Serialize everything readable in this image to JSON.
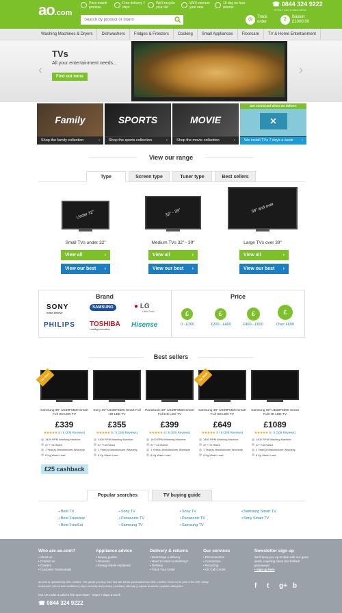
{
  "header": {
    "logo": "ao",
    "logo_domain": ".com",
    "search_placeholder": "Search by product or brand",
    "usps": [
      "Price match promise",
      "Free delivery 7 days",
      "We'll recycle your old",
      "We'll connect your new",
      "15 day no fuss returns"
    ],
    "phone": "0844 324 9222",
    "phone_sub": "OPEN 7 DAYS 8AM-10PM",
    "track_label": "Track order",
    "basket_label": "Basket",
    "basket_amount": "£1000.00",
    "basket_count": "2"
  },
  "nav": [
    "Washing Machines & Dryers",
    "Dishwashers",
    "Fridges & Freezers",
    "Cooking",
    "Small Appliances",
    "Floorcare",
    "TV & Home Entertainment"
  ],
  "hero": {
    "title": "TVs",
    "subtitle": "All your entertainment needs...",
    "button": "Find out more"
  },
  "collections": [
    {
      "art": "Family",
      "label": "Shop the family collection"
    },
    {
      "art": "SPORTS",
      "label": "Shop the sports collection"
    },
    {
      "art": "MOVIE",
      "label": "Shop the movie collection"
    },
    {
      "art": "",
      "label": "We install TVs 7 days a week",
      "heading": "Get connected when we deliver!"
    }
  ],
  "range": {
    "title": "View our range",
    "tabs": [
      "Type",
      "Screen type",
      "Tuner type",
      "Best sellers"
    ],
    "items": [
      {
        "diag": "Under 32\"",
        "caption": "Small TVs under 32\"",
        "view_all": "View all",
        "view_best": "View our best"
      },
      {
        "diag": "32\" - 39\"",
        "caption": "Medium TVs 32\" - 39\"",
        "view_all": "View all",
        "view_best": "View our best"
      },
      {
        "diag": "39\" and over",
        "caption": "Large TVs over 39\"",
        "view_all": "View all",
        "view_best": "View our best"
      }
    ]
  },
  "brand": {
    "title": "Brand",
    "logos": [
      "SONY",
      "SAMSUNG",
      "LG",
      "PHILIPS",
      "TOSHIBA",
      "Hisense"
    ],
    "sony_tagline": "make.believe",
    "lg_tagline": "Life's Good",
    "toshiba_tagline": "Leading Innovation"
  },
  "price": {
    "title": "Price",
    "ranges": [
      "0 - £200",
      "£200 - £400",
      "£400 - £600",
      "Over £600"
    ],
    "symbol": "£"
  },
  "best_sellers": {
    "title": "Best sellers",
    "badge": "Our Best",
    "products": [
      {
        "name": "Samsung 39\" UE39F5500 Smart Full HD LED TV",
        "price": "£339",
        "rating": "★★★★★",
        "reviews": "5 / 5 (306 Reviews)",
        "badge": true
      },
      {
        "name": "Sony 39\" UE39F5500 Smart Full HD LED TV",
        "price": "£355",
        "rating": "★★★★★",
        "reviews": "5 / 5 (306 Reviews)",
        "badge": false
      },
      {
        "name": "Panasonic 39\" UE39F5500 Smart Full HD LED TV",
        "price": "£399",
        "rating": "★★★★★",
        "reviews": "5 / 5 (306 Reviews)",
        "badge": false
      },
      {
        "name": "Samsung 39\" UE39F5500 Smart Full HD LED TV",
        "price": "£649",
        "rating": "★★★★★",
        "reviews": "5 / 5 (306 Reviews)",
        "badge": true
      },
      {
        "name": "Samsung 39\" UE39F5500 Smart Full HD LED TV",
        "price": "£1089",
        "rating": "★★★★★",
        "reviews": "5 / 5 (306 Reviews)",
        "badge": false
      }
    ],
    "features": [
      "1400 RPM Washing Machine",
      "A+++/A Rated",
      "1 Year(s) Manufacturer Warranty",
      "8 Kg Wash Load"
    ],
    "cashback": "£25 cashback"
  },
  "popular": {
    "tabs": [
      "Popular searches",
      "TV buying guide"
    ],
    "columns": [
      [
        "Best TV",
        "Best Freeview",
        "Best FreeSat"
      ],
      [
        "Sony TV",
        "Panasonic TV",
        "Samsung TV"
      ],
      [
        "Sony TV",
        "Panasonic TV",
        "Samsung TV"
      ],
      [
        "Samsung Smart TV",
        "Sony Smart TV"
      ]
    ]
  },
  "footer": {
    "columns": [
      {
        "heading": "Who are ao.com?",
        "links": [
          "About us",
          "Contact us",
          "Careers",
          "Customer Testimonials"
        ]
      },
      {
        "heading": "Appliance advice",
        "links": [
          "Buying guides",
          "Glossary",
          "Energy labels explained"
        ]
      },
      {
        "heading": "Delivery & returns",
        "links": [
          "Rearrange a delivery",
          "Need to return something?",
          "Delivery",
          "Track Your Order"
        ]
      },
      {
        "heading": "Our services",
        "links": [
          "Disconnection",
          "Connection",
          "Recycling",
          "UK Call Centre"
        ]
      }
    ],
    "signup_heading": "Newsletter sign up",
    "signup_text": "We'll keep you up to date with our great deals, inspiring ideas and brilliant giveaways!",
    "signup_link": "sign up here",
    "social": [
      "f",
      "t",
      "g+",
      "b"
    ],
    "copyright": "ao.com is operated by DRL Limited. The goods you buy from this site will be purchased from DRL Limited. Proud to be part of the DRL family",
    "legal_links": "email print | terms and conditions | faqs | security and privacy | cookies | sitemap | popular products | popular categories",
    "hours": "Our UK order & advice line open 8am - 10pm 7 days a week",
    "phone": "0844 324 9222"
  }
}
